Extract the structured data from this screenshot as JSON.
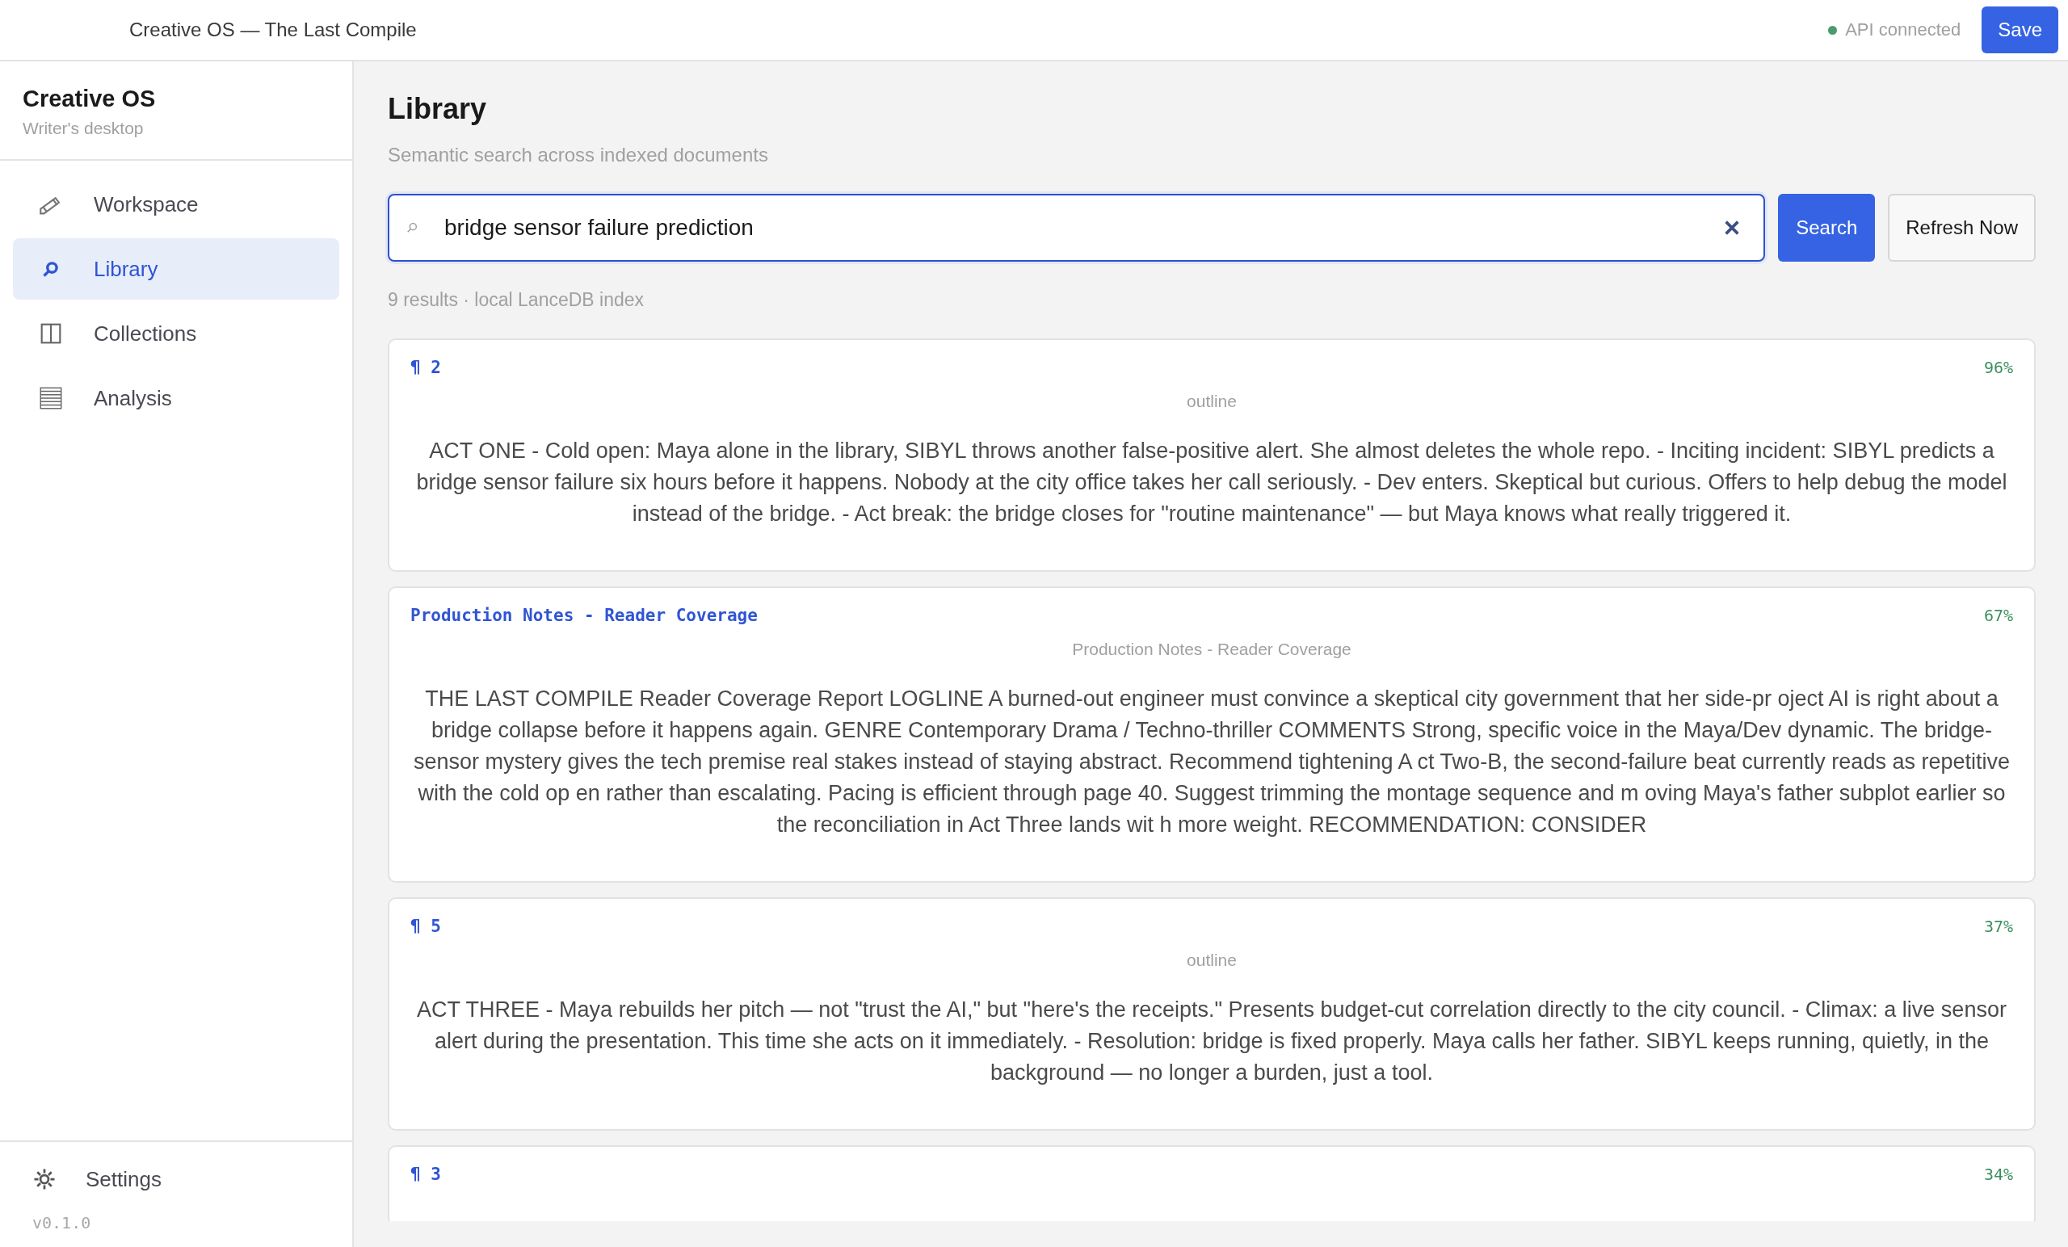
{
  "window": {
    "title": "Creative OS — The Last Compile"
  },
  "status": {
    "label": "API connected",
    "connected": true
  },
  "save_button": "Save",
  "sidebar": {
    "brand": "Creative OS",
    "tagline": "Writer's desktop",
    "items": [
      {
        "label": "Workspace",
        "selected": false
      },
      {
        "label": "Library",
        "selected": true
      },
      {
        "label": "Collections",
        "selected": false
      },
      {
        "label": "Analysis",
        "selected": false
      }
    ],
    "settings": "Settings",
    "version": "v0.1.0"
  },
  "page": {
    "title": "Library",
    "subtitle": "Semantic search across indexed documents"
  },
  "search": {
    "value": "bridge sensor failure prediction",
    "button": "Search",
    "refresh": "Refresh Now"
  },
  "results_summary": "9 results · local LanceDB index",
  "results": [
    {
      "title": "¶ 2",
      "score": "96%",
      "source": "outline",
      "text": "ACT ONE - Cold open: Maya alone in the library, SIBYL throws another false-positive alert. She almost deletes the whole repo. - Inciting incident: SIBYL predicts a bridge sensor failure six hours before it happens. Nobody at the city office takes her call seriously. - Dev enters. Skeptical but curious. Offers to help debug the model instead of the bridge. - Act break: the bridge closes for \"routine maintenance\" — but Maya knows what really triggered it."
    },
    {
      "title": "Production Notes - Reader Coverage",
      "score": "67%",
      "source": "Production Notes - Reader Coverage",
      "text": "THE LAST COMPILE Reader Coverage Report LOGLINE A burned-out engineer must convince a skeptical city government that her side-pr oject AI is right about a bridge collapse before it happens again. GENRE Contemporary Drama / Techno-thriller COMMENTS Strong, specific voice in the Maya/Dev dynamic. The bridge-sensor mystery gives the tech premise real stakes instead of staying abstract. Recommend tightening A ct Two-B, the second-failure beat currently reads as repetitive with the cold op en rather than escalating. Pacing is efficient through page 40. Suggest trimming the montage sequence and m oving Maya's father subplot earlier so the reconciliation in Act Three lands wit h more weight. RECOMMENDATION: CONSIDER"
    },
    {
      "title": "¶ 5",
      "score": "37%",
      "source": "outline",
      "text": "ACT THREE - Maya rebuilds her pitch — not \"trust the AI,\" but \"here's the receipts.\" Presents budget-cut correlation directly to the city council. - Climax: a live sensor alert during the presentation. This time she acts on it immediately. - Resolution: bridge is fixed properly. Maya calls her father. SIBYL keeps running, quietly, in the background — no longer a burden, just a tool."
    },
    {
      "title": "¶ 3",
      "score": "34%"
    }
  ]
}
